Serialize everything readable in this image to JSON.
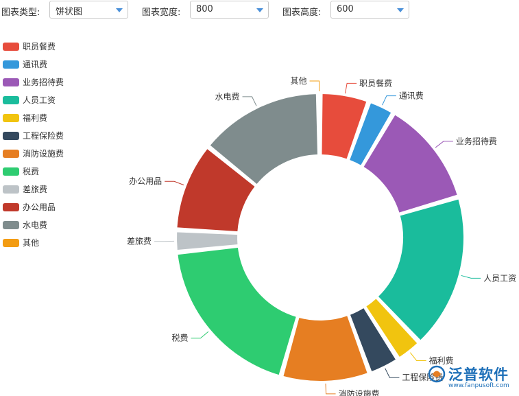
{
  "controls": {
    "type_label": "图表类型:",
    "type_value": "饼状图",
    "width_label": "图表宽度:",
    "width_value": "800",
    "height_label": "图表高度:",
    "height_value": "600"
  },
  "colors": {
    "accent": "#4a90d9",
    "select_border": "#c8c8c8"
  },
  "chart_data": {
    "type": "pie",
    "variant": "donut",
    "legend_position": "left",
    "categories": [
      "职员餐费",
      "通讯费",
      "业务招待费",
      "人员工资",
      "福利费",
      "工程保险费",
      "消防设施费",
      "税费",
      "差旅费",
      "办公用品",
      "水电费",
      "其他"
    ],
    "values": [
      5.5,
      3.0,
      12.0,
      17.5,
      3.0,
      3.5,
      10.0,
      19.0,
      2.5,
      10.0,
      14.0,
      0.2
    ],
    "colors": [
      "#e74c3c",
      "#3498db",
      "#9b59b6",
      "#1abc9c",
      "#f1c40f",
      "#34495e",
      "#e67e22",
      "#2ecc71",
      "#bdc3c7",
      "#c0392b",
      "#7f8c8d",
      "#f39c12"
    ]
  },
  "watermark": {
    "text": "泛普软件",
    "url": "www.fanpusoft.com"
  }
}
